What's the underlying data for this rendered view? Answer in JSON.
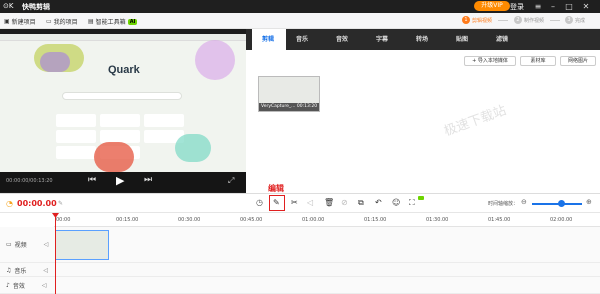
{
  "titlebar": {
    "logo": "⊙K",
    "app_name": "快鸭剪辑",
    "vip_label": "升级VIP",
    "login_label": "登录"
  },
  "menu": {
    "new_project": "新建项目",
    "my_projects": "我的项目",
    "ai_tools": "智能工具箱",
    "ai_badge": "AI"
  },
  "steps": [
    {
      "num": "1",
      "label": "剪辑视频"
    },
    {
      "num": "2",
      "label": "制作视频"
    },
    {
      "num": "3",
      "label": "完成"
    }
  ],
  "tabs": [
    "剪辑",
    "音乐",
    "音效",
    "字幕",
    "转场",
    "贴图",
    "滤镜"
  ],
  "media": {
    "import_label": "+ 导入本地媒体",
    "library_label": "素材库",
    "web_images_label": "网络图片",
    "clip_name": "VeryCapture_...",
    "clip_duration": "00:13:20",
    "watermark": "极速下载站"
  },
  "preview": {
    "time": "00:00:00/00:13:20",
    "brand": "Quark"
  },
  "annotation": {
    "label": "编辑",
    "color": "#e02020"
  },
  "timeline": {
    "current_time": "00:00.00",
    "zoom_label": "时间轴缩放：",
    "ticks": [
      "00:00",
      "00:15.00",
      "00:30.00",
      "00:45.00",
      "01:00.00",
      "01:15.00",
      "01:30.00",
      "01:45.00",
      "02:00.00"
    ],
    "tracks": [
      "视频",
      "音乐",
      "音效"
    ]
  },
  "colors": {
    "accent": "#1a73e8",
    "vip": "#ff8a00",
    "step_active": "#ff7b1a"
  }
}
